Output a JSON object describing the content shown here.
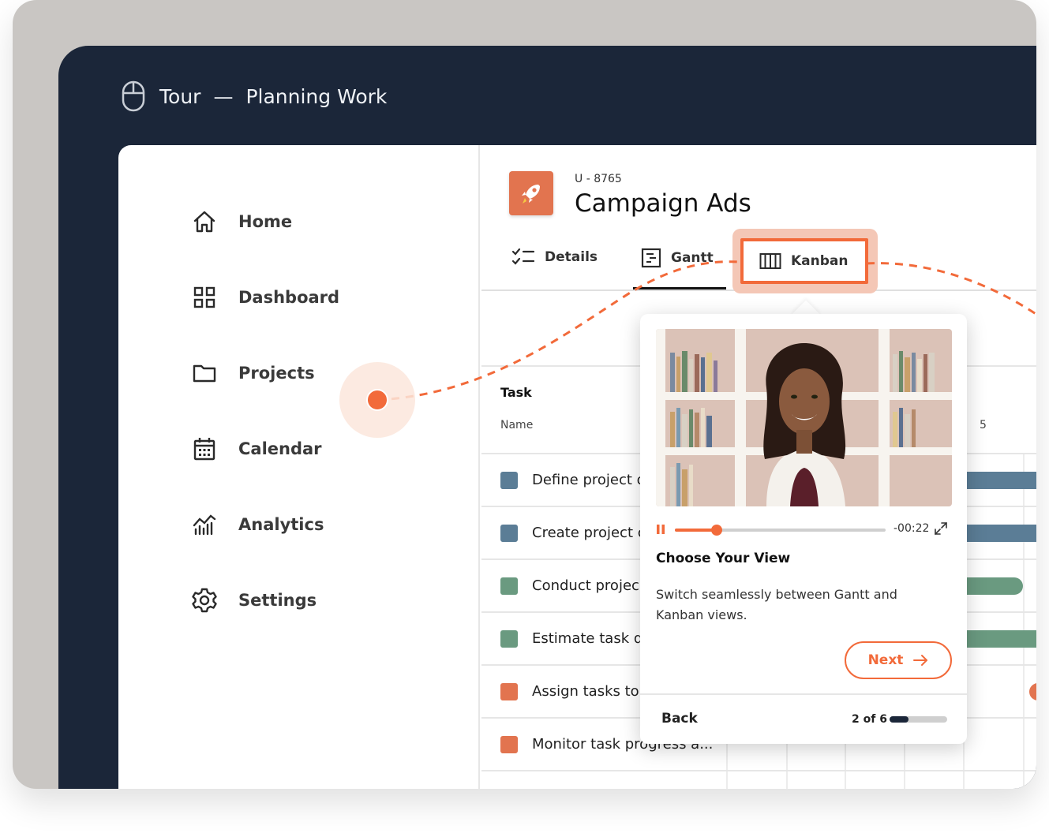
{
  "window": {
    "title": "Tour",
    "separator": "—",
    "subtitle": "Planning Work",
    "icon": "mouse-icon"
  },
  "sidebar": {
    "items": [
      {
        "label": "Home",
        "icon": "home-icon"
      },
      {
        "label": "Dashboard",
        "icon": "grid-icon"
      },
      {
        "label": "Projects",
        "icon": "folder-icon"
      },
      {
        "label": "Calendar",
        "icon": "calendar-icon"
      },
      {
        "label": "Analytics",
        "icon": "chart-icon"
      },
      {
        "label": "Settings",
        "icon": "gear-icon"
      }
    ]
  },
  "project": {
    "id": "U - 8765",
    "title": "Campaign Ads",
    "icon": "rocket-icon"
  },
  "tabs": [
    {
      "label": "Details",
      "icon": "checklist-icon"
    },
    {
      "label": "Gantt",
      "icon": "gantt-icon",
      "active": true
    },
    {
      "label": "Kanban",
      "icon": "kanban-icon",
      "highlighted": true
    }
  ],
  "table": {
    "group_header": "Task",
    "column_header": "Name",
    "timeline_label": "5",
    "rows": [
      {
        "name": "Define project o",
        "color": "#5b7d96"
      },
      {
        "name": "Create project c",
        "color": "#5b7d96"
      },
      {
        "name": "Conduct projec",
        "color": "#6a9a80"
      },
      {
        "name": "Estimate task d",
        "color": "#6a9a80"
      },
      {
        "name": "Assign tasks to",
        "color": "#e2744f"
      },
      {
        "name": "Monitor task progress a...",
        "color": "#e2744f"
      }
    ]
  },
  "popover": {
    "time": "-00:22",
    "progress_fraction": 0.2,
    "title": "Choose Your View",
    "description": "Switch seamlessly between Gantt and Kanban views.",
    "next_label": "Next",
    "back_label": "Back",
    "step_text": "2 of 6",
    "step_current": 2,
    "step_total": 6
  },
  "colors": {
    "accent": "#f26a3a",
    "dark": "#1b2639",
    "blue_task": "#5b7d96",
    "green_task": "#6a9a80",
    "orange_task": "#e2744f"
  }
}
